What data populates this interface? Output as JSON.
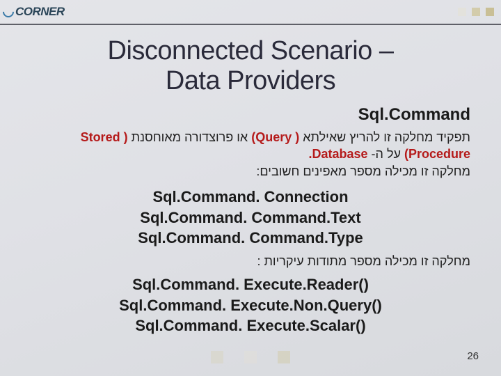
{
  "logo": {
    "text": "CORNER"
  },
  "title_line1": "Disconnected Scenario –",
  "title_line2": "Data Providers",
  "subtitle": "Sql.Command",
  "hebrew1_prefix": "Stored ) ",
  "hebrew1_mid": "תנסחואמ הרודצורפ וא",
  "hebrew1_query": " (Query ) ",
  "hebrew1_suffix": "אתליאש ץירהל וז הקלחמ דיקפת",
  "hebrew2_left": ".Database ",
  "hebrew2_mid": "-ה לע",
  "hebrew2_proc": " (Procedure",
  "hebrew3": ":םיבושח םיניפאמ רפסמ הליכמ וז הקלחמ",
  "prop1": "Sql.Command. Connection",
  "prop2": "Sql.Command. Command.Text",
  "prop3": "Sql.Command. Command.Type",
  "hebrew4": "מחלקה זו מכילה מספר מתודות עיקריות :",
  "method1": "Sql.Command. Execute.Reader()",
  "method2": "Sql.Command. Execute.Non.Query()",
  "method3": "Sql.Command. Execute.Scalar()",
  "page_number": "26"
}
